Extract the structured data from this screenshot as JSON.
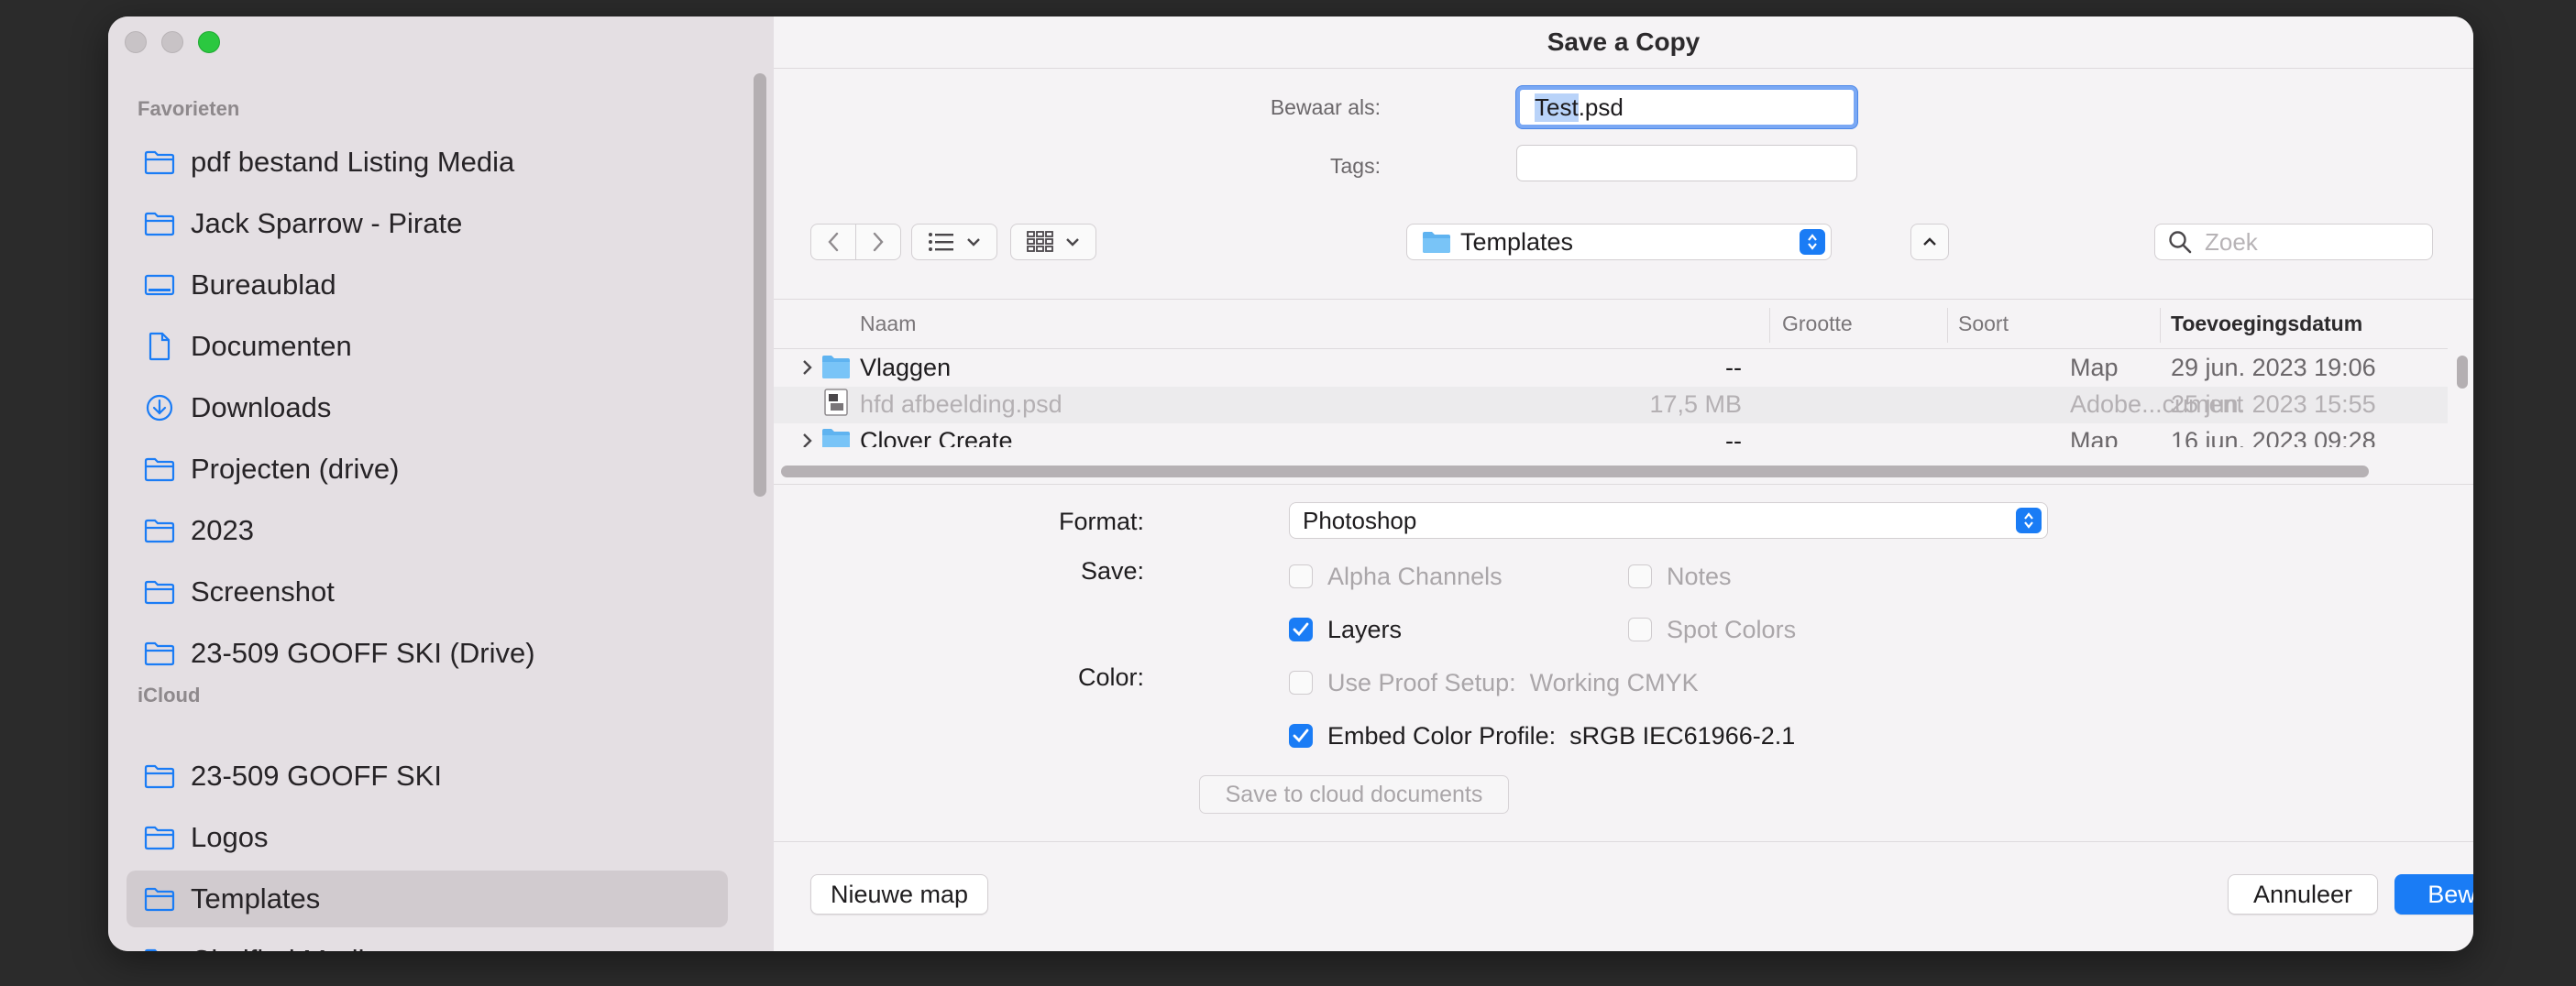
{
  "dialog": {
    "title": "Save a Copy"
  },
  "sidebar": {
    "favorites_header": "Favorieten",
    "favorites": [
      {
        "label": "pdf bestand Listing Media",
        "icon": "folder-icon"
      },
      {
        "label": "Jack Sparrow - Pirate",
        "icon": "folder-icon"
      },
      {
        "label": "Bureaublad",
        "icon": "desktop-icon"
      },
      {
        "label": "Documenten",
        "icon": "document-icon"
      },
      {
        "label": "Downloads",
        "icon": "download-icon"
      },
      {
        "label": "Projecten (drive)",
        "icon": "folder-icon"
      },
      {
        "label": "2023",
        "icon": "folder-icon"
      },
      {
        "label": "Screenshot",
        "icon": "folder-icon"
      },
      {
        "label": "23-509 GOOFF SKI (Drive)",
        "icon": "folder-icon"
      }
    ],
    "icloud_header": "iCloud",
    "icloud": [
      {
        "label": "23-509 GOOFF SKI",
        "icon": "folder-icon"
      },
      {
        "label": "Logos",
        "icon": "folder-icon"
      },
      {
        "label": "Templates",
        "icon": "folder-icon",
        "selected": true
      },
      {
        "label": "Clarified Media",
        "icon": "folder-icon"
      }
    ]
  },
  "save_as": {
    "label": "Bewaar als:",
    "name_selected": "Test",
    "name_ext": ".psd"
  },
  "tags": {
    "label": "Tags:",
    "value": ""
  },
  "location": {
    "label": "Templates"
  },
  "search": {
    "placeholder": "Zoek"
  },
  "columns": {
    "name": "Naam",
    "size": "Grootte",
    "kind": "Soort",
    "date": "Toevoegingsdatum"
  },
  "files": [
    {
      "name": "Vlaggen",
      "size": "--",
      "kind": "Map",
      "date": "29 jun. 2023 19:06",
      "type": "folder",
      "dimmed": false
    },
    {
      "name": "hfd afbeelding.psd",
      "size": "17,5 MB",
      "kind": "Adobe...cument",
      "date": "25 jun. 2023 15:55",
      "type": "psd",
      "dimmed": true
    },
    {
      "name": "Clover Create",
      "size": "--",
      "kind": "Map",
      "date": "16 jun. 2023 09:28",
      "type": "folder",
      "dimmed": false
    }
  ],
  "options": {
    "format_label": "Format:",
    "format_value": "Photoshop",
    "save_label": "Save:",
    "alpha_channels": "Alpha Channels",
    "notes": "Notes",
    "layers": "Layers",
    "spot_colors": "Spot Colors",
    "color_label": "Color:",
    "use_proof": "Use Proof Setup:",
    "proof_value": "Working CMYK",
    "embed_profile": "Embed Color Profile:",
    "profile_value": "sRGB IEC61966-2.1",
    "cloud_button": "Save to cloud documents"
  },
  "buttons": {
    "new_folder": "Nieuwe map",
    "cancel": "Annuleer",
    "save": "Bewaar"
  },
  "colors": {
    "accent": "#1a7cf5",
    "sidebar_bg": "#e4dfe3",
    "selection": "#d1cbcf"
  }
}
